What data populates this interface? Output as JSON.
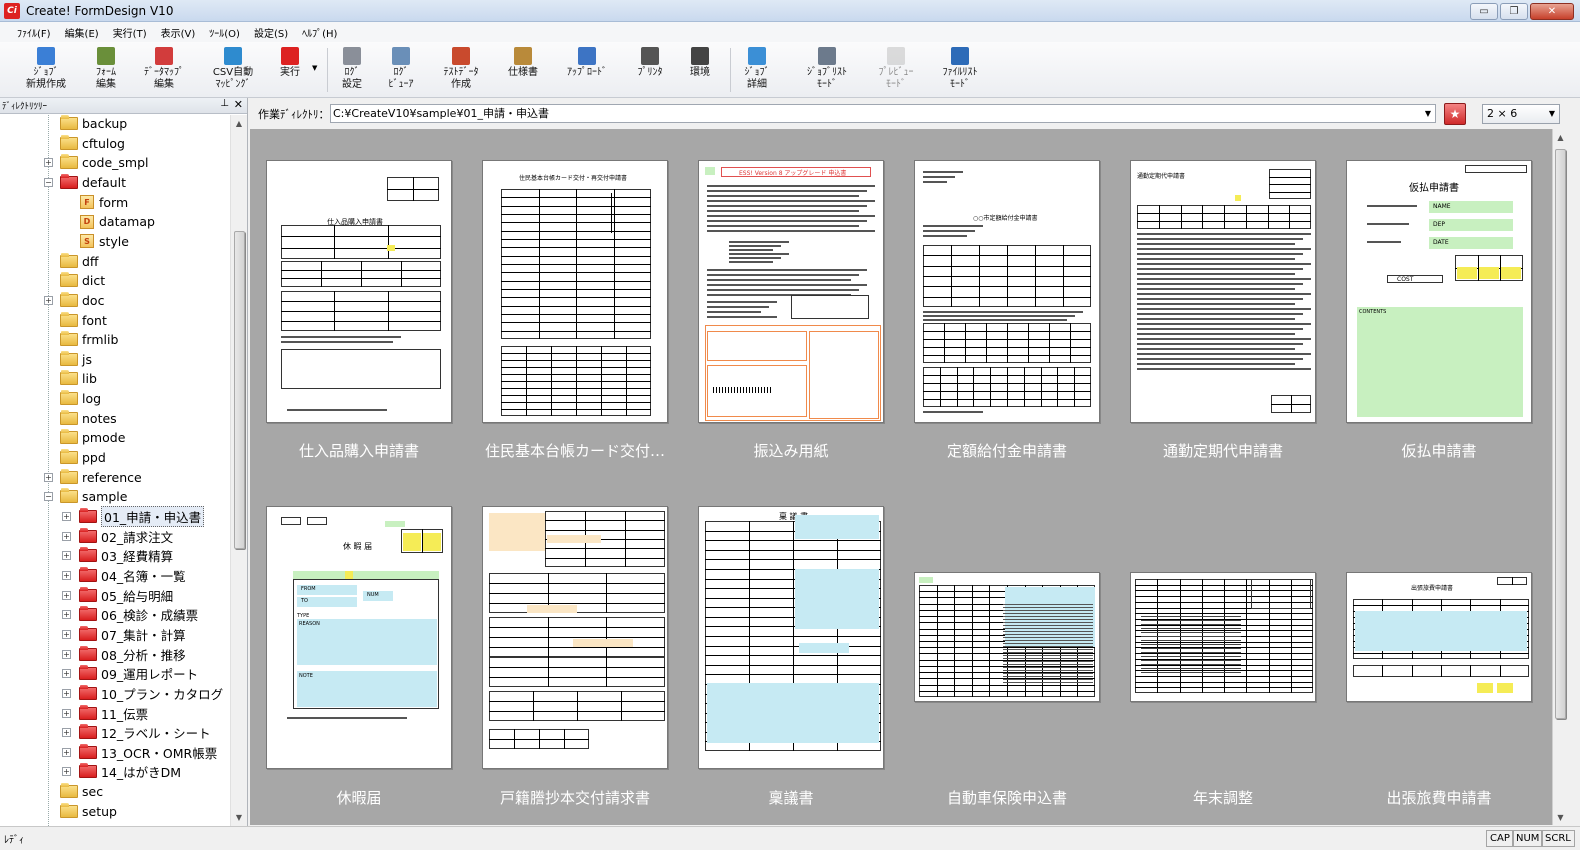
{
  "window": {
    "title": "Create! FormDesign V10",
    "icon": "Ci"
  },
  "window_controls": {
    "minimize": "▭",
    "restore": "❐",
    "close": "✕"
  },
  "menu": [
    "ﾌｧｲﾙ(F)",
    "編集(E)",
    "実行(T)",
    "表示(V)",
    "ﾂｰﾙ(O)",
    "設定(S)",
    "ﾍﾙﾌﾟ(H)"
  ],
  "toolbar": [
    {
      "name": "new-job",
      "label": "ｼﾞｮﾌﾞ\n新規作成",
      "icon": "new-job-icon"
    },
    {
      "name": "form-edit",
      "label": "ﾌｫｰﾑ\n編集",
      "icon": "form-edit-icon"
    },
    {
      "name": "datamap-edit",
      "label": "ﾃﾞｰﾀﾏｯﾌﾟ\n編集",
      "icon": "datamap-icon"
    },
    {
      "name": "csv-auto-map",
      "label": "CSV自動\nﾏｯﾋﾟﾝｸﾞ",
      "icon": "csv-icon"
    },
    {
      "name": "run",
      "label": "実行",
      "icon": "run-icon"
    },
    {
      "name": "log-settings",
      "label": "ﾛｸﾞ\n設定",
      "icon": "log-settings-icon"
    },
    {
      "name": "log-viewer",
      "label": "ﾛｸﾞ\nﾋﾞｭｰｱ",
      "icon": "log-viewer-icon"
    },
    {
      "name": "test-data",
      "label": "ﾃｽﾄﾃﾞｰﾀ\n作成",
      "icon": "test-data-icon"
    },
    {
      "name": "spec",
      "label": "仕様書",
      "icon": "spec-icon"
    },
    {
      "name": "upload",
      "label": "ｱｯﾌﾟﾛｰﾄﾞ",
      "icon": "upload-icon"
    },
    {
      "name": "printer",
      "label": "ﾌﾟﾘﾝﾀ",
      "icon": "printer-icon"
    },
    {
      "name": "environment",
      "label": "環境",
      "icon": "tools-icon"
    },
    {
      "name": "job-detail",
      "label": "ｼﾞｮﾌﾞ\n詳細",
      "icon": "job-detail-icon"
    },
    {
      "name": "job-list-mode",
      "label": "ｼﾞｮﾌﾞﾘｽﾄ\nﾓｰﾄﾞ",
      "icon": "list-icon"
    },
    {
      "name": "preview-mode",
      "label": "ﾌﾟﾚﾋﾞｭｰ\nﾓｰﾄﾞ",
      "icon": "preview-icon",
      "disabled": true
    },
    {
      "name": "file-list-mode",
      "label": "ﾌｧｲﾙﾘｽﾄ\nﾓｰﾄﾞ",
      "icon": "file-list-icon"
    }
  ],
  "directory_pane": {
    "title": "ﾃﾞｨﾚｸﾄﾘﾂﾘｰ",
    "pin": "ᵖ",
    "close": "✕"
  },
  "tree": [
    {
      "label": "backup",
      "color": "y"
    },
    {
      "label": "cftulog",
      "color": "y"
    },
    {
      "label": "code_smpl",
      "color": "y",
      "expander": "+"
    },
    {
      "label": "default",
      "color": "r",
      "expander": "−"
    },
    {
      "label": "form",
      "icon": "F",
      "depth": 1
    },
    {
      "label": "datamap",
      "icon": "D",
      "depth": 1
    },
    {
      "label": "style",
      "icon": "S",
      "depth": 1
    },
    {
      "label": "dff",
      "color": "y"
    },
    {
      "label": "dict",
      "color": "y"
    },
    {
      "label": "doc",
      "color": "y",
      "expander": "+"
    },
    {
      "label": "font",
      "color": "y"
    },
    {
      "label": "frmlib",
      "color": "y"
    },
    {
      "label": "js",
      "color": "y"
    },
    {
      "label": "lib",
      "color": "y"
    },
    {
      "label": "log",
      "color": "y"
    },
    {
      "label": "notes",
      "color": "y"
    },
    {
      "label": "pmode",
      "color": "y"
    },
    {
      "label": "ppd",
      "color": "y"
    },
    {
      "label": "reference",
      "color": "y",
      "expander": "+"
    },
    {
      "label": "sample",
      "color": "y",
      "expander": "−"
    },
    {
      "label": "01_申請・申込書",
      "color": "r",
      "depth": 1,
      "expander": "+",
      "selected": true
    },
    {
      "label": "02_請求注文",
      "color": "r",
      "depth": 1,
      "expander": "+"
    },
    {
      "label": "03_経費精算",
      "color": "r",
      "depth": 1,
      "expander": "+"
    },
    {
      "label": "04_名簿・一覧",
      "color": "r",
      "depth": 1,
      "expander": "+"
    },
    {
      "label": "05_給与明細",
      "color": "r",
      "depth": 1,
      "expander": "+"
    },
    {
      "label": "06_検診・成績票",
      "color": "r",
      "depth": 1,
      "expander": "+"
    },
    {
      "label": "07_集計・計算",
      "color": "r",
      "depth": 1,
      "expander": "+"
    },
    {
      "label": "08_分析・推移",
      "color": "r",
      "depth": 1,
      "expander": "+"
    },
    {
      "label": "09_運用レポート",
      "color": "r",
      "depth": 1,
      "expander": "+"
    },
    {
      "label": "10_プラン・カタログ",
      "color": "r",
      "depth": 1,
      "expander": "+"
    },
    {
      "label": "11_伝票",
      "color": "r",
      "depth": 1,
      "expander": "+"
    },
    {
      "label": "12_ラベル・シート",
      "color": "r",
      "depth": 1,
      "expander": "+"
    },
    {
      "label": "13_OCR・OMR帳票",
      "color": "r",
      "depth": 1,
      "expander": "+"
    },
    {
      "label": "14_はがきDM",
      "color": "r",
      "depth": 1,
      "expander": "+"
    },
    {
      "label": "sec",
      "color": "y"
    },
    {
      "label": "setup",
      "color": "y"
    }
  ],
  "pathbar": {
    "label": "作業ﾃﾞｨﾚｸﾄﾘ：",
    "path": "C:¥CreateV10¥sample¥01_申請・申込書",
    "layout": "2 × 6"
  },
  "forms": [
    {
      "label": "仕入品購入申請書",
      "title": "仕入品購入申請書",
      "kind": "purchase"
    },
    {
      "label": "住民基本台帳カード交付…",
      "title": "住民基本台帳カード交付・再交付申請書",
      "kind": "juki"
    },
    {
      "label": "振込み用紙",
      "title": "ESS! Version 8 アップグレード 申込書",
      "kind": "transfer"
    },
    {
      "label": "定額給付金申請書",
      "title": "○○市定額給付金申請書",
      "kind": "kyufu"
    },
    {
      "label": "通勤定期代申請書",
      "title": "通勤定期代申請書",
      "kind": "commute"
    },
    {
      "label": "仮払申請書",
      "title": "仮払申請書",
      "fields": [
        "NAME",
        "DEP",
        "DATE",
        "COST",
        "CONTENTS"
      ],
      "kind": "advance"
    },
    {
      "label": "休暇届",
      "title": "休 暇 届",
      "fields": [
        "FROM",
        "TO",
        "NUM",
        "TYPE",
        "REASON",
        "NOTE"
      ],
      "kind": "leave"
    },
    {
      "label": "戸籍謄抄本交付請求書",
      "title": "",
      "kind": "koseki"
    },
    {
      "label": "稟議書",
      "title": "稟 議 書",
      "kind": "ringi"
    },
    {
      "label": "自動車保険申込書",
      "title": "",
      "kind": "car"
    },
    {
      "label": "年末調整",
      "title": "",
      "kind": "nenmatsu"
    },
    {
      "label": "出張旅費申請書",
      "title": "出張旅費申請書",
      "kind": "travel"
    }
  ],
  "status": {
    "text": "ﾚﾃﾞｨ",
    "indicators": [
      "CAP",
      "NUM",
      "SCRL"
    ]
  },
  "colors": {
    "gallery_bg": "#a7a7a7",
    "folder_red": "#d81e1e",
    "folder_yellow": "#e8b940"
  }
}
